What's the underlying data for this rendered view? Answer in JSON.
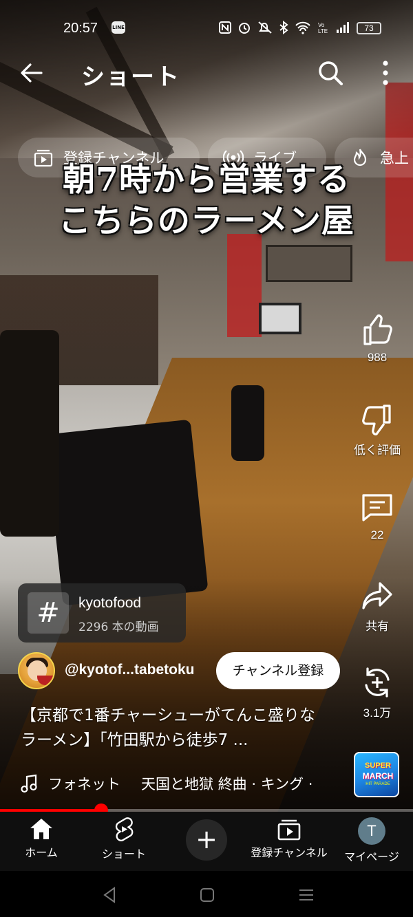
{
  "status_bar": {
    "time": "20:57",
    "line_badge": "LINE",
    "battery": "73",
    "icons": [
      "nfc-icon",
      "alarm-icon",
      "mute-icon",
      "bluetooth-icon",
      "wifi-icon",
      "volte-icon",
      "signal-icon"
    ]
  },
  "top_bar": {
    "title": "ショート"
  },
  "chips": [
    {
      "label": "登録チャンネル",
      "icon": "subscriptions-icon"
    },
    {
      "label": "ライブ",
      "icon": "live-icon"
    },
    {
      "label": "急上",
      "icon": "trending-icon"
    }
  ],
  "video": {
    "caption_line1": "朝7時から営業する",
    "caption_line2": "こちらのラーメン屋"
  },
  "actions": {
    "like_count": "988",
    "dislike_label": "低く評価",
    "comment_count": "22",
    "share_label": "共有",
    "remix_count": "3.1万"
  },
  "hashtag": {
    "symbol": "#",
    "name": "kyotofood",
    "count": "2296 本の動画"
  },
  "channel": {
    "handle": "@kyotof...tabetoku",
    "subscribe_label": "チャンネル登録"
  },
  "description": "【京都で1番チャーシューがてんこ盛りなラーメン】「竹田駅から徒歩7 ...",
  "music": {
    "artist": "フォネット",
    "track": "天国と地獄 終曲 · キング ·",
    "album_line1": "SUPER",
    "album_line2": "MARCH",
    "album_line3": "HIT PARADE"
  },
  "progress": {
    "fraction": 0.245
  },
  "bottom_nav": {
    "home": "ホーム",
    "shorts": "ショート",
    "create": "+",
    "subscriptions": "登録チャンネル",
    "me": "マイページ",
    "me_initial": "T"
  },
  "colors": {
    "accent": "#ff0000",
    "nav_bg": "#0f0f0f"
  }
}
